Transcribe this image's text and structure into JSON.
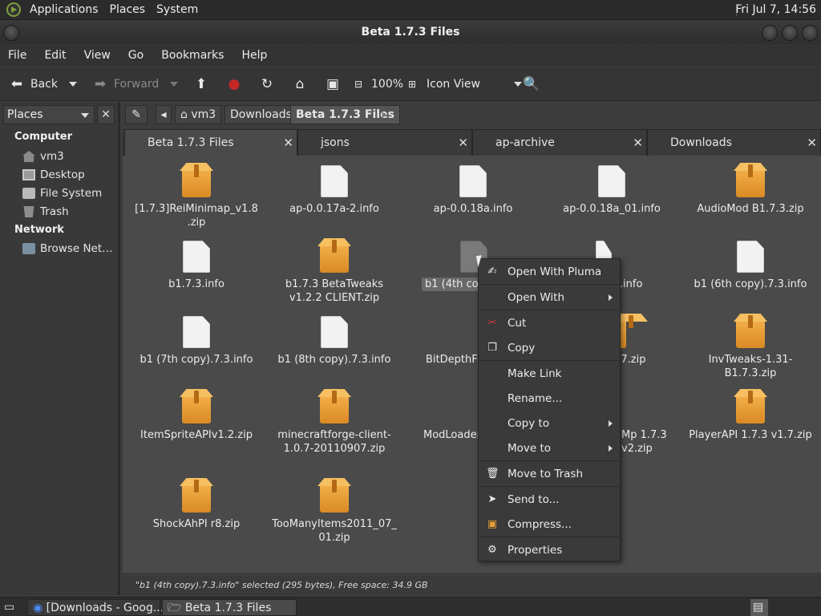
{
  "top_panel": {
    "menus": [
      "Applications",
      "Places",
      "System"
    ],
    "clock": "Fri Jul  7, 14:56"
  },
  "window": {
    "title": "Beta 1.7.3 Files"
  },
  "menubar": [
    "File",
    "Edit",
    "View",
    "Go",
    "Bookmarks",
    "Help"
  ],
  "toolbar": {
    "back": "Back",
    "forward": "Forward",
    "zoom": "100%",
    "view_mode": "Icon View"
  },
  "sidebar": {
    "selector": "Places",
    "computer_heading": "Computer",
    "computer_items": [
      "vm3",
      "Desktop",
      "File System",
      "Trash"
    ],
    "network_heading": "Network",
    "network_items": [
      "Browse Net…"
    ]
  },
  "pathbar": {
    "crumbs": [
      "vm3",
      "Downloads",
      "Beta 1.7.3 Files"
    ]
  },
  "tabs": [
    {
      "label": "Beta 1.7.3 Files",
      "active": true
    },
    {
      "label": "jsons",
      "active": false
    },
    {
      "label": "ap-archive",
      "active": false
    },
    {
      "label": "Downloads",
      "active": false
    }
  ],
  "files": [
    {
      "name": "[1.7.3]ReiMinimap_v1.8.zip",
      "type": "zip"
    },
    {
      "name": "ap-0.0.17a-2.info",
      "type": "doc"
    },
    {
      "name": "ap-0.0.18a.info",
      "type": "doc"
    },
    {
      "name": "ap-0.0.18a_01.info",
      "type": "doc"
    },
    {
      "name": "AudioMod B1.7.3.zip",
      "type": "zip"
    },
    {
      "name": "b1.7.3.info",
      "type": "doc"
    },
    {
      "name": "b1.7.3 BetaTweaks v1.2.2 CLIENT.zip",
      "type": "zip"
    },
    {
      "name": "b1 (4th cop",
      "type": "doc",
      "selected": true
    },
    {
      "name": ").7.3.info",
      "type": "doc"
    },
    {
      "name": "b1 (6th copy).7.3.info",
      "type": "doc"
    },
    {
      "name": "b1 (7th copy).7.3.info",
      "type": "doc"
    },
    {
      "name": "b1 (8th copy).7.3.info",
      "type": "doc"
    },
    {
      "name": "BitDepthFi",
      "type": "zip"
    },
    {
      "name": "4-1.7.zip",
      "type": "zip"
    },
    {
      "name": "InvTweaks-1.31-B1.7.3.zip",
      "type": "zip"
    },
    {
      "name": "ItemSpriteAPIv1.2.zip",
      "type": "zip"
    },
    {
      "name": "minecraftforge-client-1.0.7-20110907.zip",
      "type": "zip"
    },
    {
      "name": "ModLoader",
      "type": "zip"
    },
    {
      "name": "Mp 1.7.3 v2.zip",
      "type": "zip"
    },
    {
      "name": "PlayerAPI 1.7.3 v1.7.zip",
      "type": "zip"
    },
    {
      "name": "ShockAhPI r8.zip",
      "type": "zip"
    },
    {
      "name": "TooManyItems2011_07_01.zip",
      "type": "zip"
    }
  ],
  "context_menu": {
    "open_with_pluma": "Open With Pluma",
    "open_with": "Open With",
    "cut": "Cut",
    "copy": "Copy",
    "make_link": "Make Link",
    "rename": "Rename...",
    "copy_to": "Copy to",
    "move_to": "Move to",
    "move_to_trash": "Move to Trash",
    "send_to": "Send to...",
    "compress": "Compress...",
    "properties": "Properties"
  },
  "status": "\"b1 (4th copy).7.3.info\" selected (295 bytes), Free space: 34.9 GB",
  "taskbar": {
    "tasks": [
      "[Downloads - Goog...",
      "Beta 1.7.3 Files"
    ]
  },
  "colors": {
    "accent_green": "#7c9f3c",
    "zip_orange": "#e8a038",
    "cut_red": "#d23a3a",
    "stop_red": "#c62828",
    "search_blue": "#3b78d8"
  }
}
